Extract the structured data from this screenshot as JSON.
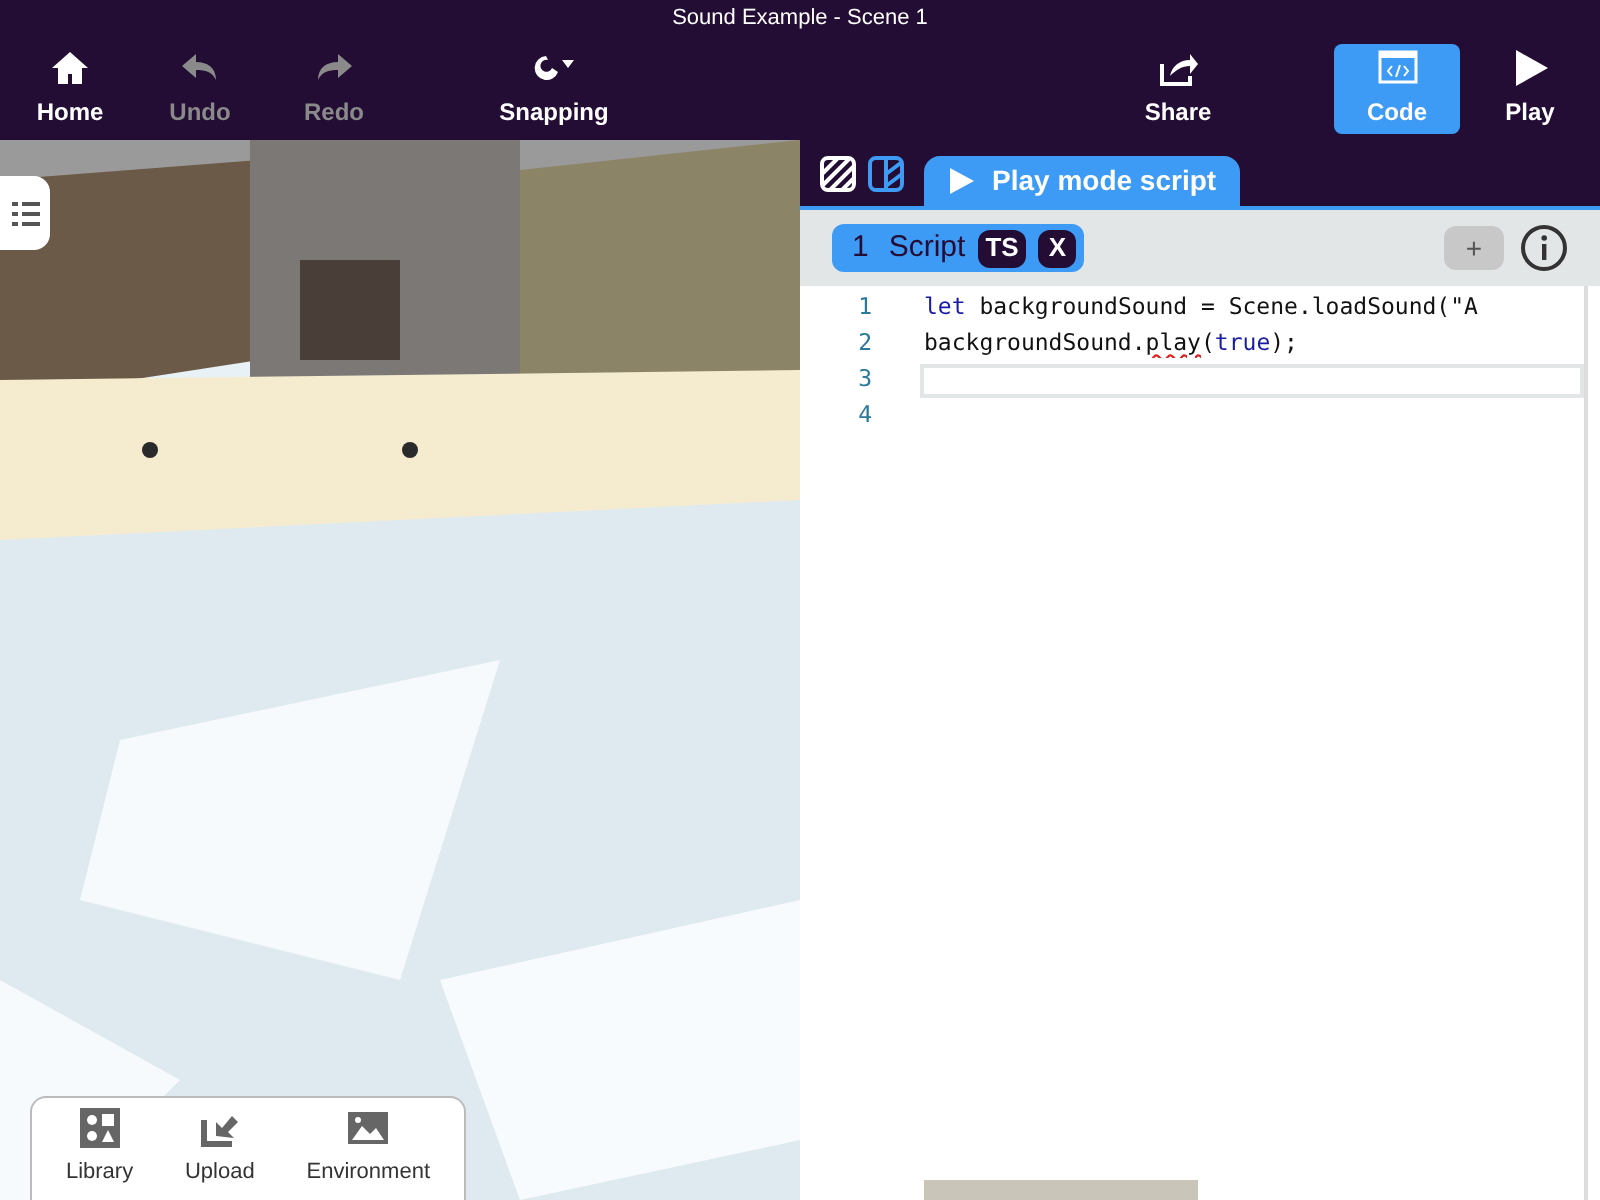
{
  "window": {
    "title": "Sound Example - Scene 1"
  },
  "toolbar": [
    {
      "label": "Home",
      "disabled": false,
      "selected": false
    },
    {
      "label": "Undo",
      "disabled": true,
      "selected": false
    },
    {
      "label": "Redo",
      "disabled": true,
      "selected": false
    },
    {
      "label": "Snapping",
      "disabled": false,
      "selected": false
    },
    {
      "label": "Share",
      "disabled": false,
      "selected": false
    },
    {
      "label": "Code",
      "disabled": false,
      "selected": true
    },
    {
      "label": "Play",
      "disabled": false,
      "selected": false
    }
  ],
  "bottom_panel": [
    {
      "label": "Library"
    },
    {
      "label": "Upload"
    },
    {
      "label": "Environment"
    }
  ],
  "editor_tab": {
    "label": "Play mode script",
    "selected": true
  },
  "script_tab": {
    "number": "1",
    "label": "Script",
    "badge": "TS",
    "close": "X"
  },
  "add_button": "+",
  "code_lines": [
    {
      "number": "1",
      "current": false,
      "tokens": [
        {
          "text": "let",
          "kind": "keyword"
        },
        {
          "text": " backgroundSound = Scene.loadSound(\"A",
          "kind": "plain"
        }
      ]
    },
    {
      "number": "2",
      "current": false,
      "tokens": [
        {
          "text": "backgroundSound.",
          "kind": "plain"
        },
        {
          "text": "play",
          "kind": "error"
        },
        {
          "text": "(",
          "kind": "plain"
        },
        {
          "text": "true",
          "kind": "keyword"
        },
        {
          "text": ");",
          "kind": "plain"
        }
      ]
    },
    {
      "number": "3",
      "current": true
    },
    {
      "number": "4",
      "current": false
    }
  ]
}
